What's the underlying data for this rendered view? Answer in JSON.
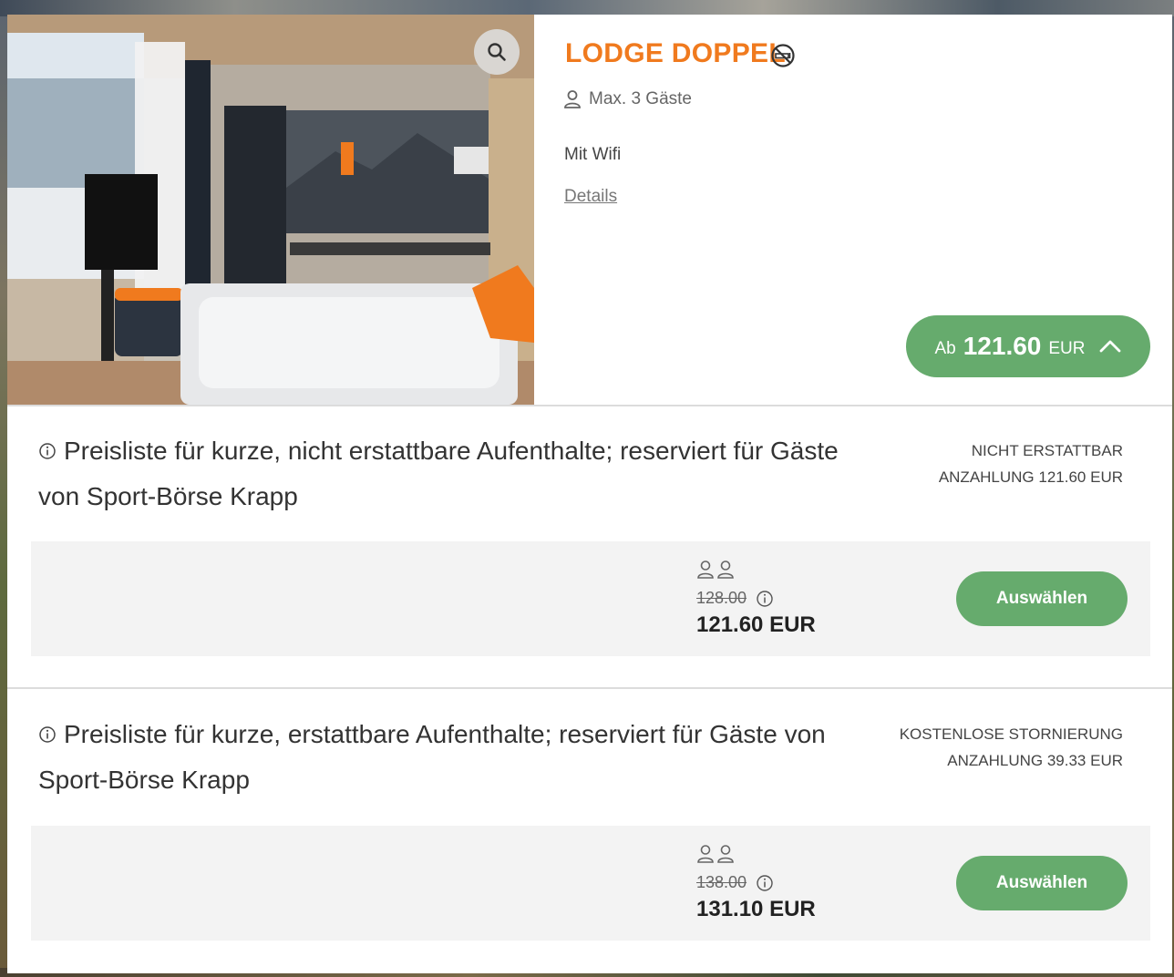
{
  "room": {
    "title": "LODGE DOPPEL",
    "guests": "Max. 3 Gäste",
    "amenity": "Mit Wifi",
    "details_link": "Details",
    "price_prefix": "Ab",
    "price_amount": "121.60",
    "price_currency": "EUR"
  },
  "rates": [
    {
      "title": "Preisliste für kurze, nicht erstattbare Aufenthalte; reserviert für Gäste von Sport-Börse Krapp",
      "policy": "NICHT ERSTATTBAR",
      "deposit": "ANZAHLUNG 121.60 EUR",
      "old_price": "128.00",
      "price": "121.60 EUR",
      "select_label": "Auswählen"
    },
    {
      "title": "Preisliste für kurze, erstattbare Aufenthalte; reserviert für Gäste von Sport-Börse Krapp",
      "policy": "KOSTENLOSE STORNIERUNG",
      "deposit": "ANZAHLUNG 39.33 EUR",
      "old_price": "138.00",
      "price": "131.10 EUR",
      "select_label": "Auswählen"
    }
  ],
  "colors": {
    "accent_orange": "#f07a1e",
    "button_green": "#66ab6d",
    "offer_bg": "#f3f3f3"
  },
  "icons": [
    "search-icon",
    "no-smoking-icon",
    "person-icon",
    "info-icon",
    "chevron-up-icon"
  ]
}
